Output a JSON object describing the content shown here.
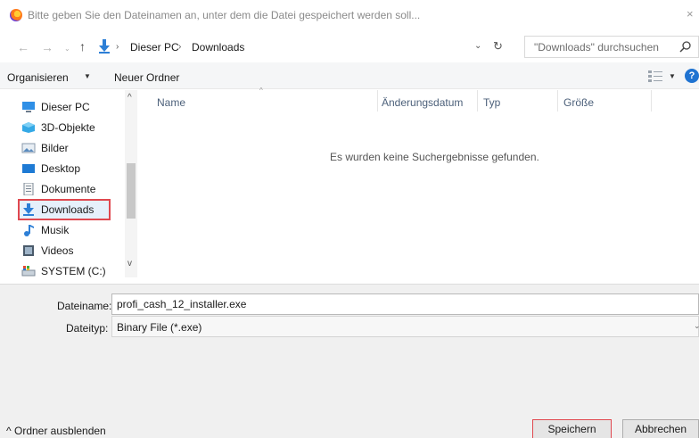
{
  "window": {
    "title": "Bitte geben Sie den Dateinamen an, unter dem die Datei gespeichert werden soll...",
    "close_glyph": "×"
  },
  "nav": {
    "back_glyph": "←",
    "forward_glyph": "→",
    "recent_glyph": "⌄",
    "up_glyph": "↑",
    "breadcrumb": [
      "Dieser PC",
      "Downloads"
    ],
    "crumb_sep": "›",
    "dropdown_glyph": "⌄",
    "refresh_glyph": "↻"
  },
  "search": {
    "placeholder": "\"Downloads\" durchsuchen"
  },
  "toolbar": {
    "organize_label": "Organisieren",
    "caret": "▼",
    "new_folder_label": "Neuer Ordner",
    "help_glyph": "?"
  },
  "sidebar": {
    "items": [
      {
        "label": "Dieser PC",
        "icon": "pc-icon"
      },
      {
        "label": "3D-Objekte",
        "icon": "3d-objects-icon"
      },
      {
        "label": "Bilder",
        "icon": "pictures-icon"
      },
      {
        "label": "Desktop",
        "icon": "desktop-icon"
      },
      {
        "label": "Dokumente",
        "icon": "documents-icon"
      },
      {
        "label": "Downloads",
        "icon": "downloads-icon",
        "selected": true
      },
      {
        "label": "Musik",
        "icon": "music-icon"
      },
      {
        "label": "Videos",
        "icon": "videos-icon"
      },
      {
        "label": "SYSTEM (C:)",
        "icon": "drive-icon"
      }
    ],
    "scroll_up": "^",
    "scroll_down": "v"
  },
  "filelist": {
    "columns": [
      "Name",
      "Änderungsdatum",
      "Typ",
      "Größe"
    ],
    "sort_glyph": "^",
    "empty_message": "Es wurden keine Suchergebnisse gefunden."
  },
  "form": {
    "filename_label": "Dateiname:",
    "filename_value": "profi_cash_12_installer.exe",
    "filetype_label": "Dateityp:",
    "filetype_value": "Binary File (*.exe)",
    "filetype_chevron": "⌄"
  },
  "footer": {
    "hide_folders_label": "Ordner ausblenden",
    "hide_folders_glyph": "^",
    "save_label": "Speichern",
    "cancel_label": "Abbrechen"
  },
  "colors": {
    "accent_blue": "#1f73d1",
    "highlight_red": "#e0484f",
    "selection_bg": "#e6f0fb",
    "panel_bg": "#f0f0f0"
  }
}
